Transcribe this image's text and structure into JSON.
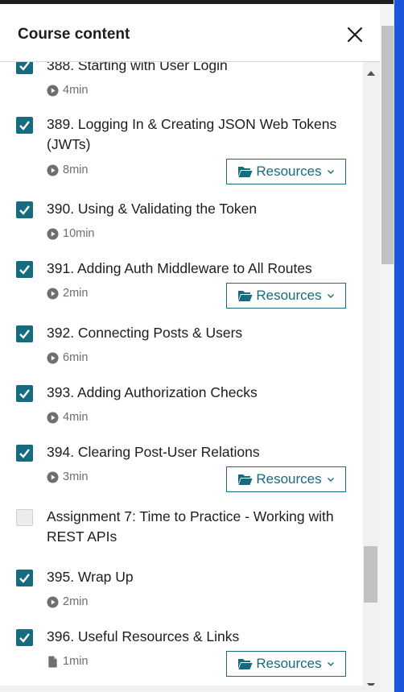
{
  "header": {
    "title": "Course content"
  },
  "colors": {
    "accent": "#166b7e",
    "text": "#1c1d1f",
    "muted": "#6a6f73"
  },
  "items": [
    {
      "title": "388. Starting with User Login",
      "duration": "4min",
      "type": "video",
      "checked": true,
      "resources": false
    },
    {
      "title": "389. Logging In & Creating JSON Web Tokens (JWTs)",
      "duration": "8min",
      "type": "video",
      "checked": true,
      "resources": true
    },
    {
      "title": "390. Using & Validating the Token",
      "duration": "10min",
      "type": "video",
      "checked": true,
      "resources": false
    },
    {
      "title": "391. Adding Auth Middleware to All Routes",
      "duration": "2min",
      "type": "video",
      "checked": true,
      "resources": true
    },
    {
      "title": "392. Connecting Posts & Users",
      "duration": "6min",
      "type": "video",
      "checked": true,
      "resources": false
    },
    {
      "title": "393. Adding Authorization Checks",
      "duration": "4min",
      "type": "video",
      "checked": true,
      "resources": false
    },
    {
      "title": "394. Clearing Post-User Relations",
      "duration": "3min",
      "type": "video",
      "checked": true,
      "resources": true
    },
    {
      "title": "Assignment 7: Time to Practice - Working with REST APIs",
      "duration": "",
      "type": "assignment",
      "checked": false,
      "resources": false
    },
    {
      "title": "395. Wrap Up",
      "duration": "2min",
      "type": "video",
      "checked": true,
      "resources": false
    },
    {
      "title": "396. Useful Resources & Links",
      "duration": "1min",
      "type": "file",
      "checked": true,
      "resources": true
    }
  ],
  "resources_label": "Resources"
}
